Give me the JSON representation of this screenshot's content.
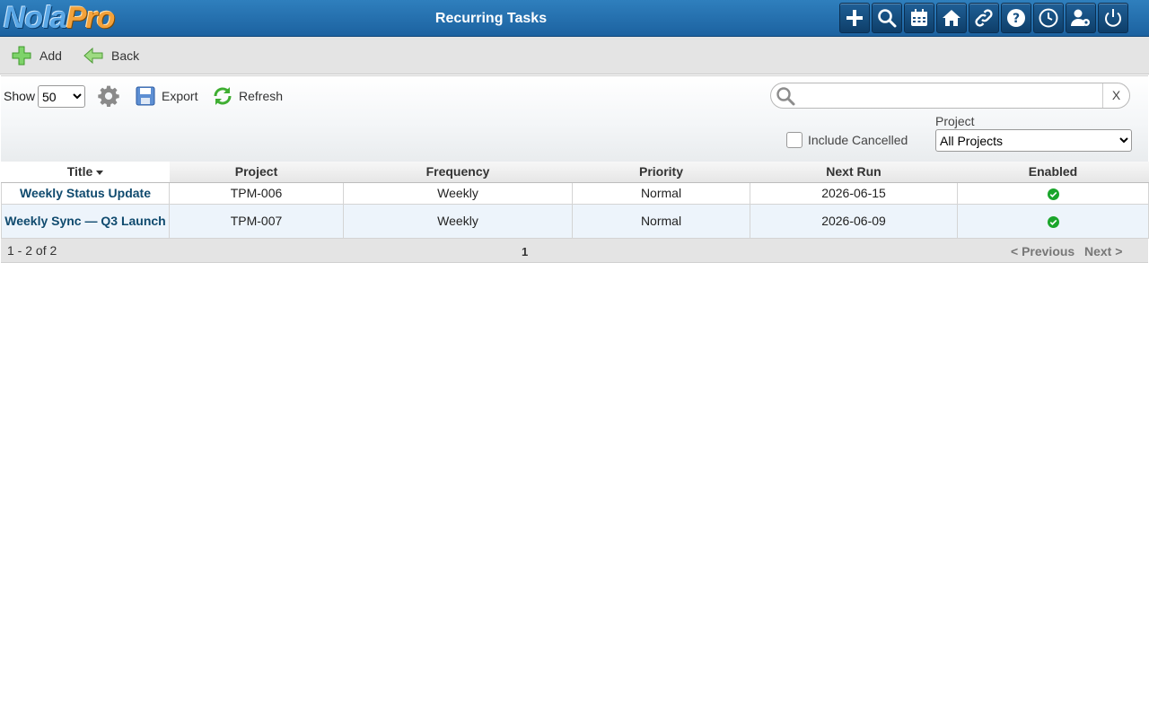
{
  "app": {
    "logo_part1": "Nola",
    "logo_part2": "Pro",
    "title": "Recurring Tasks"
  },
  "header_buttons": [
    {
      "icon": "plus-icon"
    },
    {
      "icon": "search-icon"
    },
    {
      "icon": "calendar-icon"
    },
    {
      "icon": "home-icon"
    },
    {
      "icon": "link-icon"
    },
    {
      "icon": "help-icon"
    },
    {
      "icon": "clock-icon"
    },
    {
      "icon": "user-settings-icon"
    },
    {
      "icon": "power-icon"
    }
  ],
  "actionbar": {
    "add_label": "Add",
    "back_label": "Back"
  },
  "filter": {
    "show_label": "Show",
    "show_value": "50",
    "export_label": "Export",
    "refresh_label": "Refresh",
    "search_value": "",
    "search_clear": "X",
    "include_cancelled_label": "Include Cancelled",
    "project_label": "Project",
    "project_value": "All Projects"
  },
  "table": {
    "columns": [
      "Title",
      "Project",
      "Frequency",
      "Priority",
      "Next Run",
      "Enabled"
    ],
    "rows": [
      {
        "title": "Weekly Status Update",
        "project": "TPM-006",
        "frequency": "Weekly",
        "priority": "Normal",
        "next_run": "2026-06-15",
        "enabled": true
      },
      {
        "title": "Weekly Sync — Q3 Launch",
        "project": "TPM-007",
        "frequency": "Weekly",
        "priority": "Normal",
        "next_run": "2026-06-09",
        "enabled": true
      }
    ]
  },
  "pager": {
    "count": "1 - 2 of 2",
    "page": "1",
    "prev": "< Previous",
    "next": "Next >"
  },
  "colors": {
    "header_blue": "#1c62a0",
    "enabled_green": "#1aa52b",
    "title_link": "#0f4a6e"
  }
}
